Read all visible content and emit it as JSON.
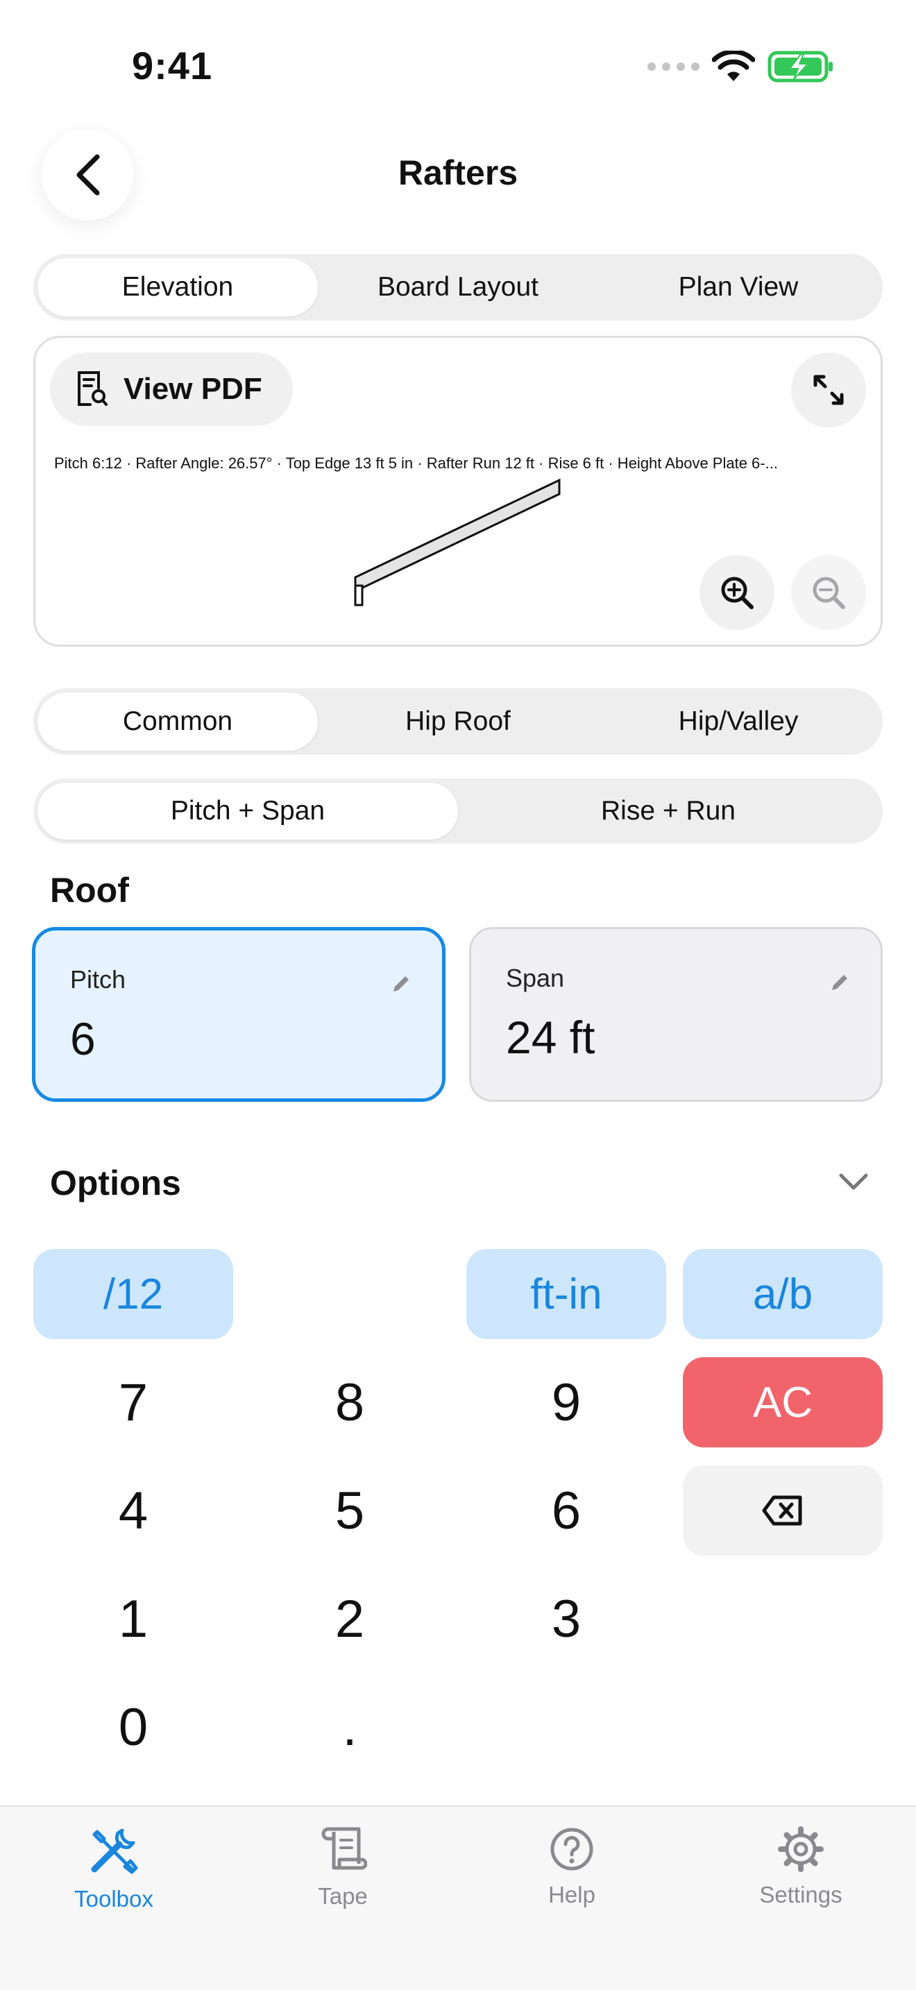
{
  "status_bar": {
    "time": "9:41"
  },
  "header": {
    "title": "Rafters"
  },
  "view_tabs": [
    {
      "label": "Elevation",
      "active": true
    },
    {
      "label": "Board Layout",
      "active": false
    },
    {
      "label": "Plan View",
      "active": false
    }
  ],
  "preview": {
    "view_pdf_label": "View PDF",
    "summary": "Pitch 6:12 · Rafter Angle: 26.57° · Top Edge 13 ft 5 in · Rafter Run 12 ft · Rise 6 ft · Height Above Plate 6-..."
  },
  "roof_type_tabs": [
    {
      "label": "Common",
      "active": true
    },
    {
      "label": "Hip Roof",
      "active": false
    },
    {
      "label": "Hip/Valley",
      "active": false
    }
  ],
  "input_mode_tabs": [
    {
      "label": "Pitch + Span",
      "active": true
    },
    {
      "label": "Rise + Run",
      "active": false
    }
  ],
  "roof": {
    "section_title": "Roof",
    "pitch": {
      "label": "Pitch",
      "value": "6"
    },
    "span": {
      "label": "Span",
      "value": "24 ft"
    }
  },
  "options": {
    "title": "Options"
  },
  "keypad": {
    "fn_pitch": "/12",
    "fn_ftin": "ft-in",
    "fn_fraction": "a/b",
    "k7": "7",
    "k8": "8",
    "k9": "9",
    "ac": "AC",
    "k4": "4",
    "k5": "5",
    "k6": "6",
    "k1": "1",
    "k2": "2",
    "k3": "3",
    "k0": "0",
    "dot": "."
  },
  "tabbar": {
    "toolbox": "Toolbox",
    "tape": "Tape",
    "help": "Help",
    "settings": "Settings"
  },
  "colors": {
    "accent": "#1a86dc",
    "selected_border": "#1689e3",
    "selected_fill": "#e6f2fd",
    "fn_key": "#cde6fc",
    "ac_key": "#f2646b",
    "battery": "#34c759"
  }
}
